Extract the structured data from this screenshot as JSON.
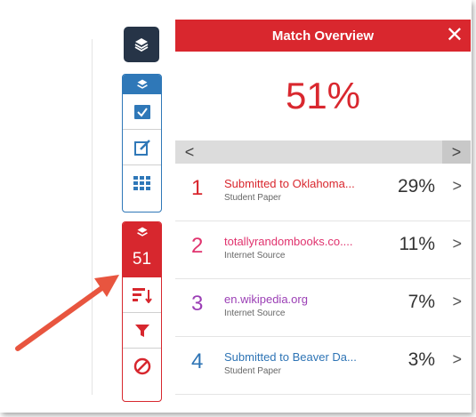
{
  "panel": {
    "title": "Match Overview",
    "close_glyph": "✕",
    "overall_percent": "51%",
    "nav": {
      "prev_glyph": "<",
      "next_glyph": ">"
    }
  },
  "sidebar": {
    "match_count": "51"
  },
  "matches": [
    {
      "rank": "1",
      "title": "Submitted to Oklahoma...",
      "source_type": "Student Paper",
      "percent": "29%",
      "color": "#d9272e"
    },
    {
      "rank": "2",
      "title": "totallyrandombooks.co....",
      "source_type": "Internet Source",
      "percent": "11%",
      "color": "#e0336e"
    },
    {
      "rank": "3",
      "title": "en.wikipedia.org",
      "source_type": "Internet Source",
      "percent": "7%",
      "color": "#9b3fb5"
    },
    {
      "rank": "4",
      "title": "Submitted to Beaver Da...",
      "source_type": "Student Paper",
      "percent": "3%",
      "color": "#2e74b5"
    }
  ],
  "colors": {
    "accent_red": "#d9272e",
    "accent_blue": "#2f78b8",
    "dark_navy": "#263447",
    "arrow": "#e8553f"
  },
  "icons": {
    "layers": "layers-icon",
    "check": "checkbox-icon",
    "edit": "edit-icon",
    "grid": "grid-icon",
    "sort": "sort-icon",
    "filter": "filter-icon",
    "exclude": "exclude-icon"
  }
}
